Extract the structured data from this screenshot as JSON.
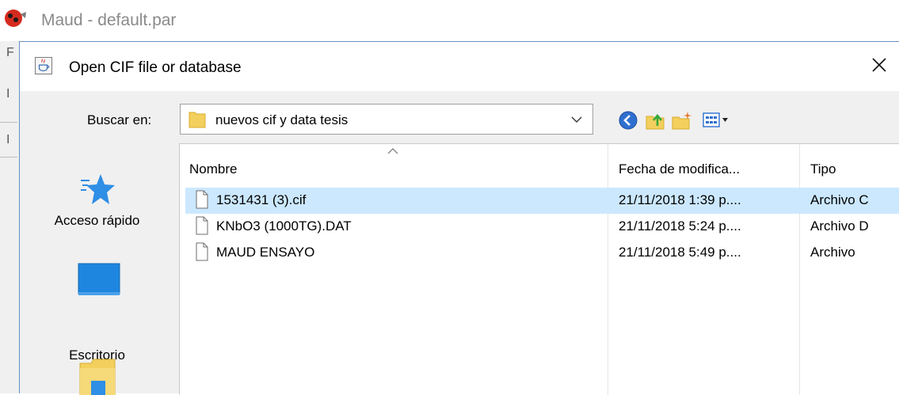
{
  "background_window": {
    "title": "Maud - default.par",
    "strip_fragments": [
      "F",
      "I",
      "I"
    ]
  },
  "dialog": {
    "title": "Open CIF file or database",
    "look_in": {
      "label": "Buscar en:",
      "value": "nuevos cif y data tesis"
    },
    "places": [
      {
        "label": "Acceso rápido",
        "icon": "star-icon"
      },
      {
        "label": "Escritorio",
        "icon": "desktop-icon"
      },
      {
        "label": "",
        "icon": "libraries-icon"
      }
    ],
    "columns": {
      "name": "Nombre",
      "date": "Fecha de modifica...",
      "type": "Tipo"
    },
    "files": [
      {
        "name": "1531431 (3).cif",
        "date": "21/11/2018 1:39 p....",
        "type": "Archivo C",
        "selected": true
      },
      {
        "name": "KNbO3 (1000TG).DAT",
        "date": "21/11/2018 5:24 p....",
        "type": "Archivo D",
        "selected": false
      },
      {
        "name": "MAUD ENSAYO",
        "date": "21/11/2018 5:49 p....",
        "type": "Archivo",
        "selected": false
      }
    ]
  },
  "colors": {
    "selection": "#cce8ff",
    "dialog_bg": "#f0f0f0",
    "folder_yellow": "#f3cf5d"
  }
}
